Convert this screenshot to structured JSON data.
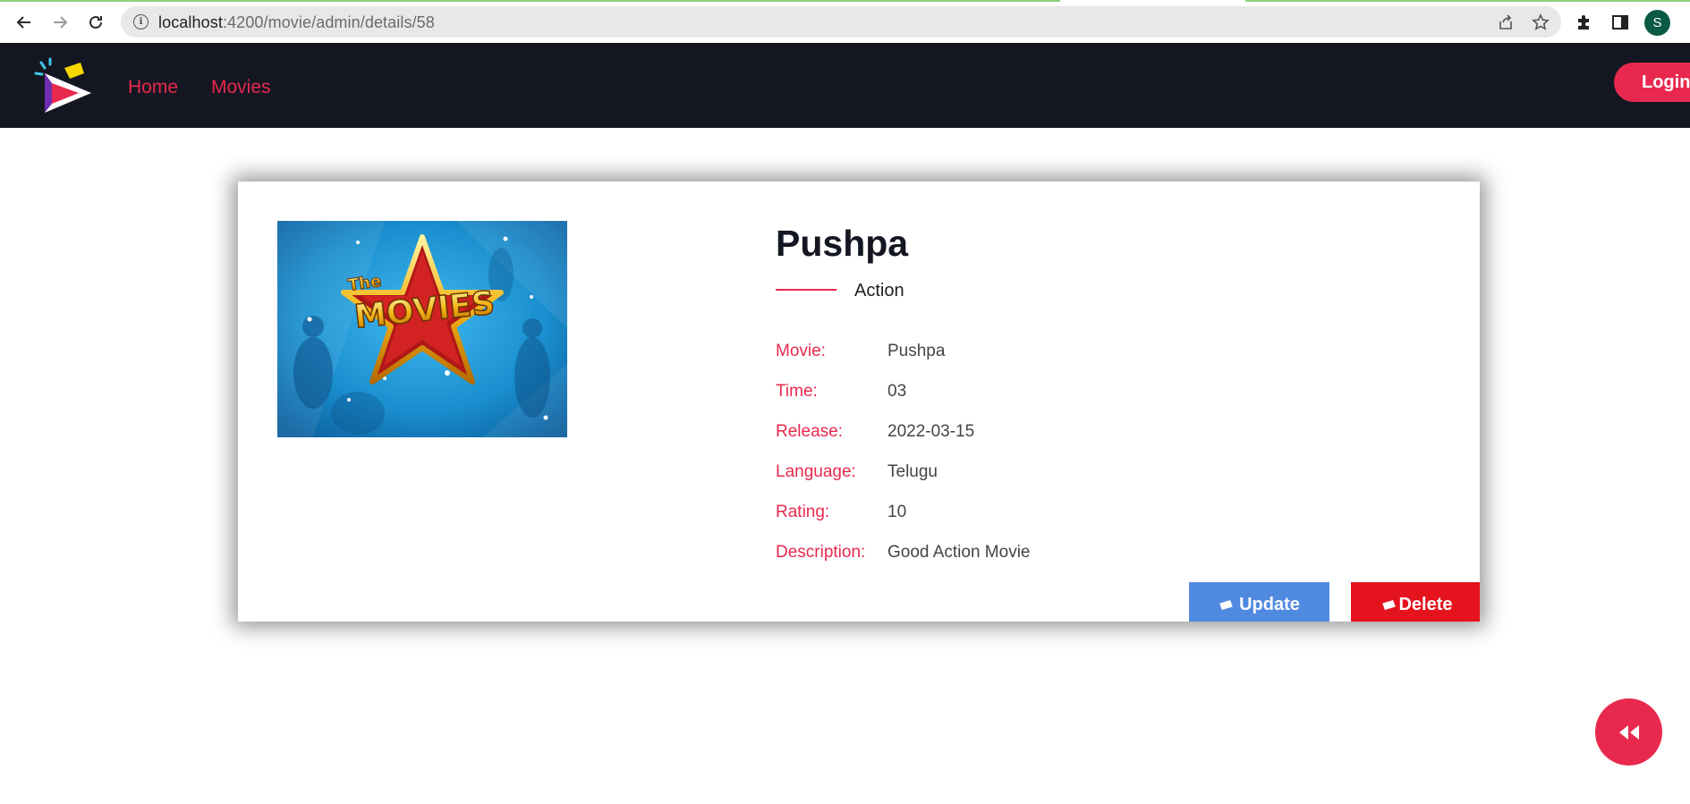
{
  "browser": {
    "url_host": "localhost",
    "url_path": ":4200/movie/admin/details/58",
    "profile_initial": "S"
  },
  "navbar": {
    "links": [
      {
        "label": "Home"
      },
      {
        "label": "Movies"
      }
    ],
    "login_label": "Login"
  },
  "movie": {
    "title": "Pushpa",
    "genre": "Action",
    "details": [
      {
        "label": "Movie:",
        "value": "Pushpa"
      },
      {
        "label": "Time:",
        "value": "03"
      },
      {
        "label": "Release:",
        "value": "2022-03-15"
      },
      {
        "label": "Language:",
        "value": "Telugu"
      },
      {
        "label": "Rating:",
        "value": "10"
      },
      {
        "label": "Description:",
        "value": "Good Action Movie"
      }
    ],
    "poster": {
      "logo_small": "The",
      "logo_big": "MOVIES"
    }
  },
  "actions": {
    "update_label": "Update",
    "delete_label": "Delete"
  },
  "colors": {
    "accent": "#e8294d",
    "navbar_bg": "#141722",
    "update_bg": "#5089e0",
    "delete_bg": "#e5131e"
  },
  "icons": {
    "back": "arrow-left-icon",
    "forward": "arrow-right-icon",
    "reload": "reload-icon",
    "site_info": "info-icon",
    "share": "share-icon",
    "bookmark": "star-icon",
    "extensions": "puzzle-icon",
    "side_panel": "side-panel-icon",
    "ticket": "ticket-icon",
    "fab": "rewind-icon"
  }
}
